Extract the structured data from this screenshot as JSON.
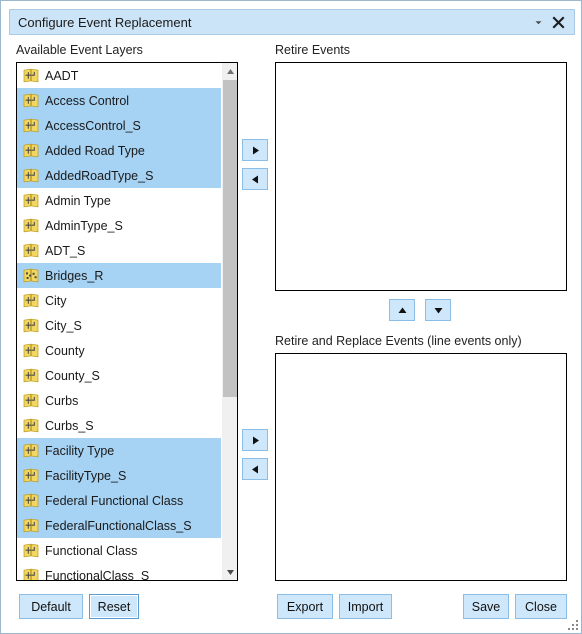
{
  "window": {
    "title": "Configure Event Replacement",
    "collapse_icon": "chevron-down-icon",
    "close_icon": "close-icon",
    "resize_grip_icon": "resize-grip-icon"
  },
  "colors": {
    "titlebar_bg": "#cce4f7",
    "titlebar_border": "#a9cbe8",
    "selection": "#a6d2f4",
    "button_bg": "#cfe7fa",
    "button_border": "#8cbde4",
    "layer_icon_fill": "#f2d661",
    "box_border": "#000000",
    "scrollbar_track": "#f0f0f0",
    "scrollbar_thumb": "#c2c2c2"
  },
  "panels": {
    "available_label": "Available Event Layers",
    "retire_label": "Retire Events",
    "retire_replace_label": "Retire and Replace Events (line events only)"
  },
  "available_layers": [
    {
      "name": "AADT",
      "icon": "line-layer-icon",
      "selected": false
    },
    {
      "name": "Access Control",
      "icon": "line-layer-icon",
      "selected": true
    },
    {
      "name": "AccessControl_S",
      "icon": "line-layer-icon",
      "selected": true
    },
    {
      "name": "Added Road Type",
      "icon": "line-layer-icon",
      "selected": true
    },
    {
      "name": "AddedRoadType_S",
      "icon": "line-layer-icon",
      "selected": true
    },
    {
      "name": "Admin Type",
      "icon": "line-layer-icon",
      "selected": false
    },
    {
      "name": "AdminType_S",
      "icon": "line-layer-icon",
      "selected": false
    },
    {
      "name": "ADT_S",
      "icon": "line-layer-icon",
      "selected": false
    },
    {
      "name": "Bridges_R",
      "icon": "point-layer-icon",
      "selected": true
    },
    {
      "name": "City",
      "icon": "line-layer-icon",
      "selected": false
    },
    {
      "name": "City_S",
      "icon": "line-layer-icon",
      "selected": false
    },
    {
      "name": "County",
      "icon": "line-layer-icon",
      "selected": false
    },
    {
      "name": "County_S",
      "icon": "line-layer-icon",
      "selected": false
    },
    {
      "name": "Curbs",
      "icon": "line-layer-icon",
      "selected": false
    },
    {
      "name": "Curbs_S",
      "icon": "line-layer-icon",
      "selected": false
    },
    {
      "name": "Facility Type",
      "icon": "line-layer-icon",
      "selected": true
    },
    {
      "name": "FacilityType_S",
      "icon": "line-layer-icon",
      "selected": true
    },
    {
      "name": "Federal Functional Class",
      "icon": "line-layer-icon",
      "selected": true
    },
    {
      "name": "FederalFunctionalClass_S",
      "icon": "line-layer-icon",
      "selected": true
    },
    {
      "name": "Functional Class",
      "icon": "line-layer-icon",
      "selected": false
    },
    {
      "name": "FunctionalClass_S",
      "icon": "line-layer-icon",
      "selected": false
    }
  ],
  "retire_events": [],
  "retire_replace_events": [],
  "transfer_buttons": {
    "add_to_retire": "play-right-icon",
    "remove_from_retire": "play-left-icon",
    "add_to_retire_replace": "play-right-icon",
    "remove_from_retire_replace": "play-left-icon",
    "move_up": "triangle-up-icon",
    "move_down": "triangle-down-icon"
  },
  "buttons": {
    "default": "Default",
    "reset": "Reset",
    "export": "Export",
    "import": "Import",
    "save": "Save",
    "close": "Close"
  },
  "scrollbar": {
    "up_icon": "scroll-up-icon",
    "down_icon": "scroll-down-icon"
  }
}
